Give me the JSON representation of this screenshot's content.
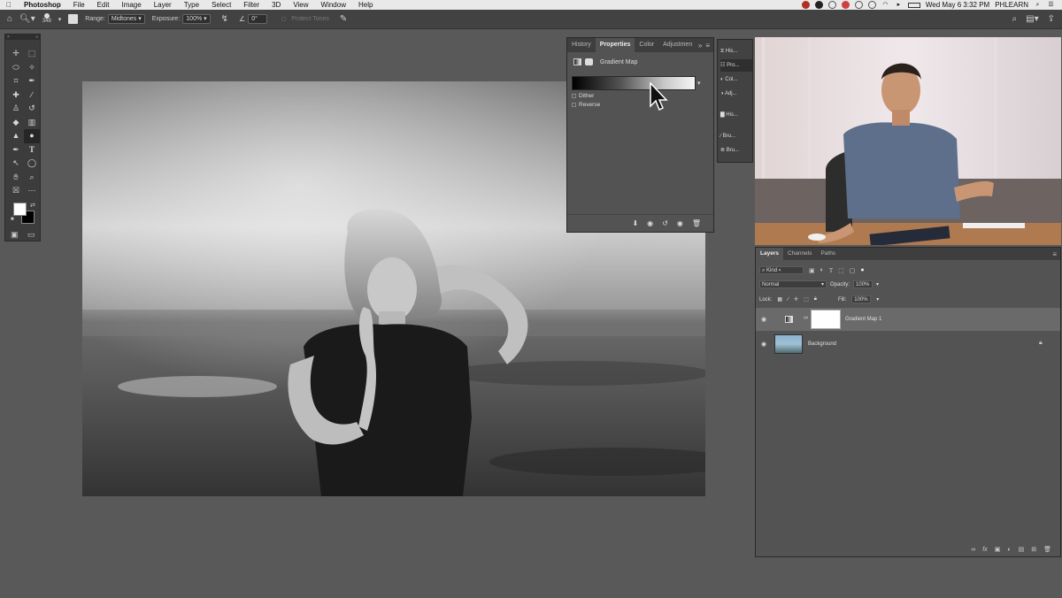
{
  "menubar": {
    "apple": "",
    "app": "Photoshop",
    "items": [
      "File",
      "Edit",
      "Image",
      "Layer",
      "Type",
      "Select",
      "Filter",
      "3D",
      "View",
      "Window",
      "Help"
    ],
    "clock": "Wed May 6  3:32 PM",
    "user": "PHLEARN"
  },
  "options": {
    "brush_size": "348",
    "range_label": "Range:",
    "range_value": "Midtones",
    "exposure_label": "Exposure:",
    "exposure_value": "100%",
    "angle_value": "0°",
    "protect_tones": "Protect Tones"
  },
  "properties": {
    "tabs": [
      "History",
      "Properties",
      "Color",
      "Adjustmen"
    ],
    "title": "Gradient Map",
    "dither": "Dither",
    "reverse": "Reverse"
  },
  "strip": {
    "items": [
      "His...",
      "Pro...",
      "Col...",
      "Adj...",
      "His...",
      "Bru...",
      "Bru..."
    ]
  },
  "layers": {
    "tabs": [
      "Layers",
      "Channels",
      "Paths"
    ],
    "kind": "Kind",
    "blend_mode": "Normal",
    "opacity_label": "Opacity:",
    "opacity_value": "100%",
    "lock_label": "Lock:",
    "fill_label": "Fill:",
    "fill_value": "100%",
    "rows": [
      {
        "name": "Gradient Map 1"
      },
      {
        "name": "Background"
      }
    ],
    "footer_icons": [
      "link-icon",
      "fx-icon",
      "mask-icon",
      "adjustment-icon",
      "group-icon",
      "new-layer-icon",
      "trash-icon"
    ]
  }
}
